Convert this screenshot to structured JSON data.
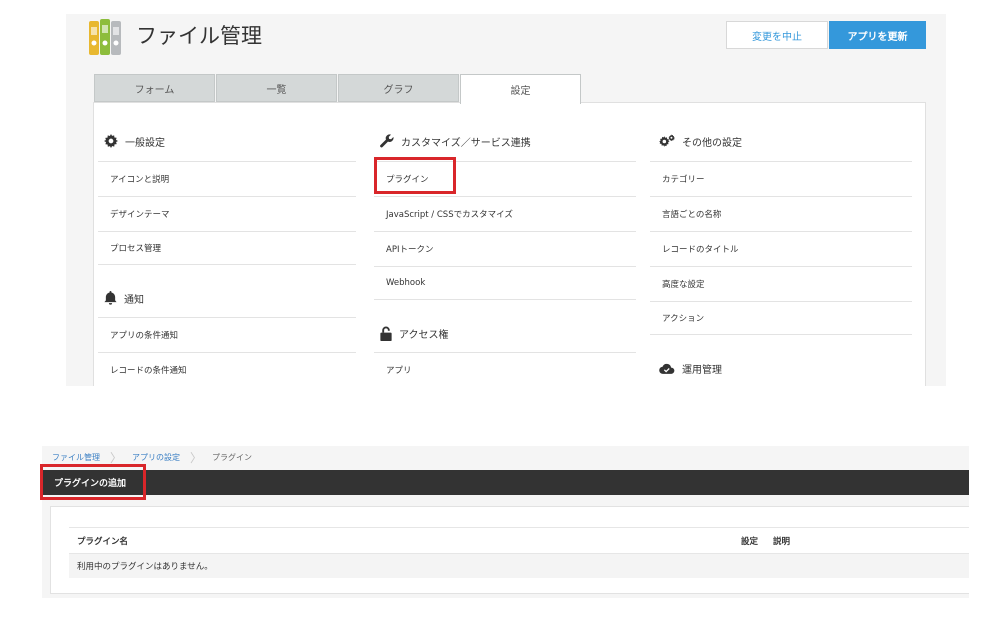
{
  "app": {
    "title": "ファイル管理",
    "cancel_label": "変更を中止",
    "update_label": "アプリを更新"
  },
  "tabs": [
    {
      "label": "フォーム"
    },
    {
      "label": "一覧"
    },
    {
      "label": "グラフ"
    },
    {
      "label": "設定",
      "active": true
    }
  ],
  "settings": {
    "general": {
      "title": "一般設定",
      "icon": "gear-icon",
      "items": [
        "アイコンと説明",
        "デザインテーマ",
        "プロセス管理"
      ]
    },
    "notify": {
      "title": "通知",
      "icon": "bell-icon",
      "items": [
        "アプリの条件通知",
        "レコードの条件通知"
      ]
    },
    "customize": {
      "title": "カスタマイズ／サービス連携",
      "icon": "wrench-icon",
      "items": [
        "プラグイン",
        "JavaScript / CSSでカスタマイズ",
        "APIトークン",
        "Webhook"
      ]
    },
    "access": {
      "title": "アクセス権",
      "icon": "lock-icon",
      "items": [
        "アプリ"
      ]
    },
    "other": {
      "title": "その他の設定",
      "icon": "gears-icon",
      "items": [
        "カテゴリー",
        "言語ごとの名称",
        "レコードのタイトル",
        "高度な設定",
        "アクション"
      ]
    },
    "operation": {
      "title": "運用管理",
      "icon": "cloud-icon"
    }
  },
  "highlight_color": "#d9262a",
  "accent_color": "#3498db",
  "breadcrumb": [
    "ファイル管理",
    "アプリの設定",
    "プラグイン"
  ],
  "plugin_page": {
    "add_label": "プラグインの追加",
    "columns": {
      "name": "プラグイン名",
      "settings": "設定",
      "description": "説明"
    },
    "empty_message": "利用中のプラグインはありません。"
  }
}
